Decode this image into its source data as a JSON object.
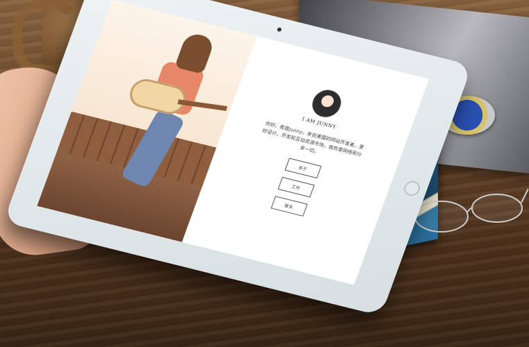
{
  "page": {
    "brand": "I AM JUNNY",
    "intro": "你好，我是Junny，来自美国的网站开发者，爱好设计，开发和互动资源市场。我热爱网络和分享一切。",
    "nav": [
      {
        "label": "关于"
      },
      {
        "label": "工作"
      },
      {
        "label": "联系"
      }
    ]
  },
  "icons": {
    "avatar": "girl-portrait-avatar-icon",
    "camera": "front-camera-icon",
    "home": "home-button-icon"
  },
  "colors": {
    "screen_bg": "#ffffff",
    "text": "#333333",
    "tablet_frame": "#e4ebed",
    "desk": "#6e4a2c"
  }
}
